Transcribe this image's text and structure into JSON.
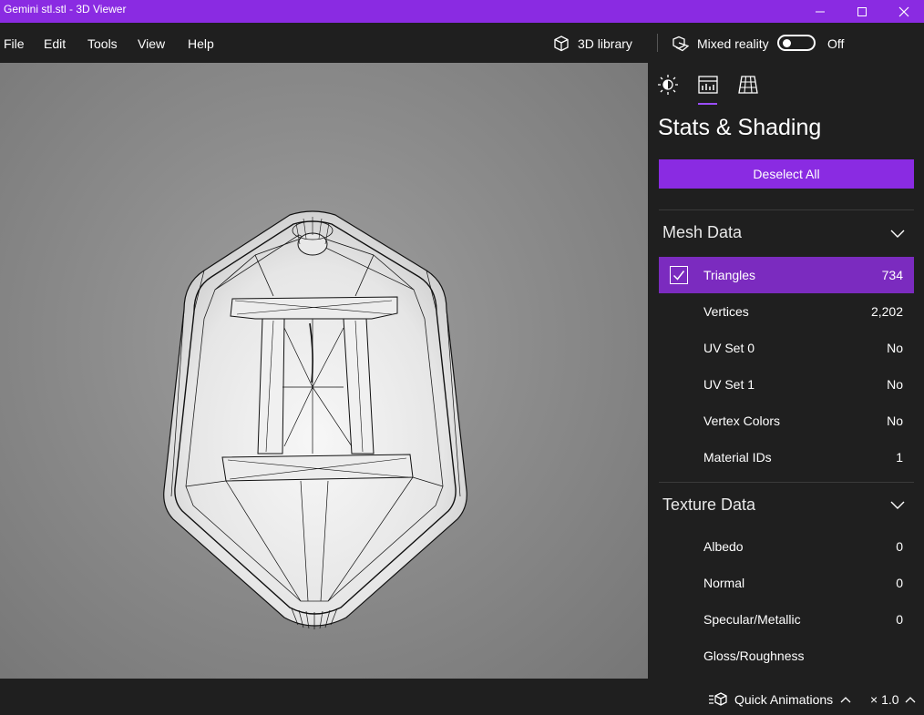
{
  "window": {
    "title": "Gemini stl.stl - 3D Viewer"
  },
  "menu": {
    "file": "File",
    "edit": "Edit",
    "tools": "Tools",
    "view": "View",
    "help": "Help"
  },
  "toolbar": {
    "library_label": "3D library",
    "mixed_reality_label": "Mixed reality",
    "mixed_reality_state": "Off"
  },
  "panel": {
    "tabs": [
      {
        "icon": "lighting-icon"
      },
      {
        "icon": "stats-icon",
        "active": true
      },
      {
        "icon": "grid-icon"
      }
    ],
    "title": "Stats & Shading",
    "deselect_label": "Deselect All",
    "mesh_section": {
      "title": "Mesh Data",
      "rows": [
        {
          "label": "Triangles",
          "value": "734",
          "checked": true
        },
        {
          "label": "Vertices",
          "value": "2,202"
        },
        {
          "label": "UV Set 0",
          "value": "No"
        },
        {
          "label": "UV Set 1",
          "value": "No"
        },
        {
          "label": "Vertex Colors",
          "value": "No"
        },
        {
          "label": "Material IDs",
          "value": "1"
        }
      ]
    },
    "texture_section": {
      "title": "Texture Data",
      "rows": [
        {
          "label": "Albedo",
          "value": "0"
        },
        {
          "label": "Normal",
          "value": "0"
        },
        {
          "label": "Specular/Metallic",
          "value": "0"
        },
        {
          "label": "Gloss/Roughness",
          "value": ""
        }
      ]
    }
  },
  "statusbar": {
    "quick_animations_label": "Quick Animations",
    "speed_label": "× 1.0"
  },
  "colors": {
    "accent": "#8a2be2",
    "chrome": "#1f1f1f",
    "selected_row": "#7b2bbf"
  }
}
